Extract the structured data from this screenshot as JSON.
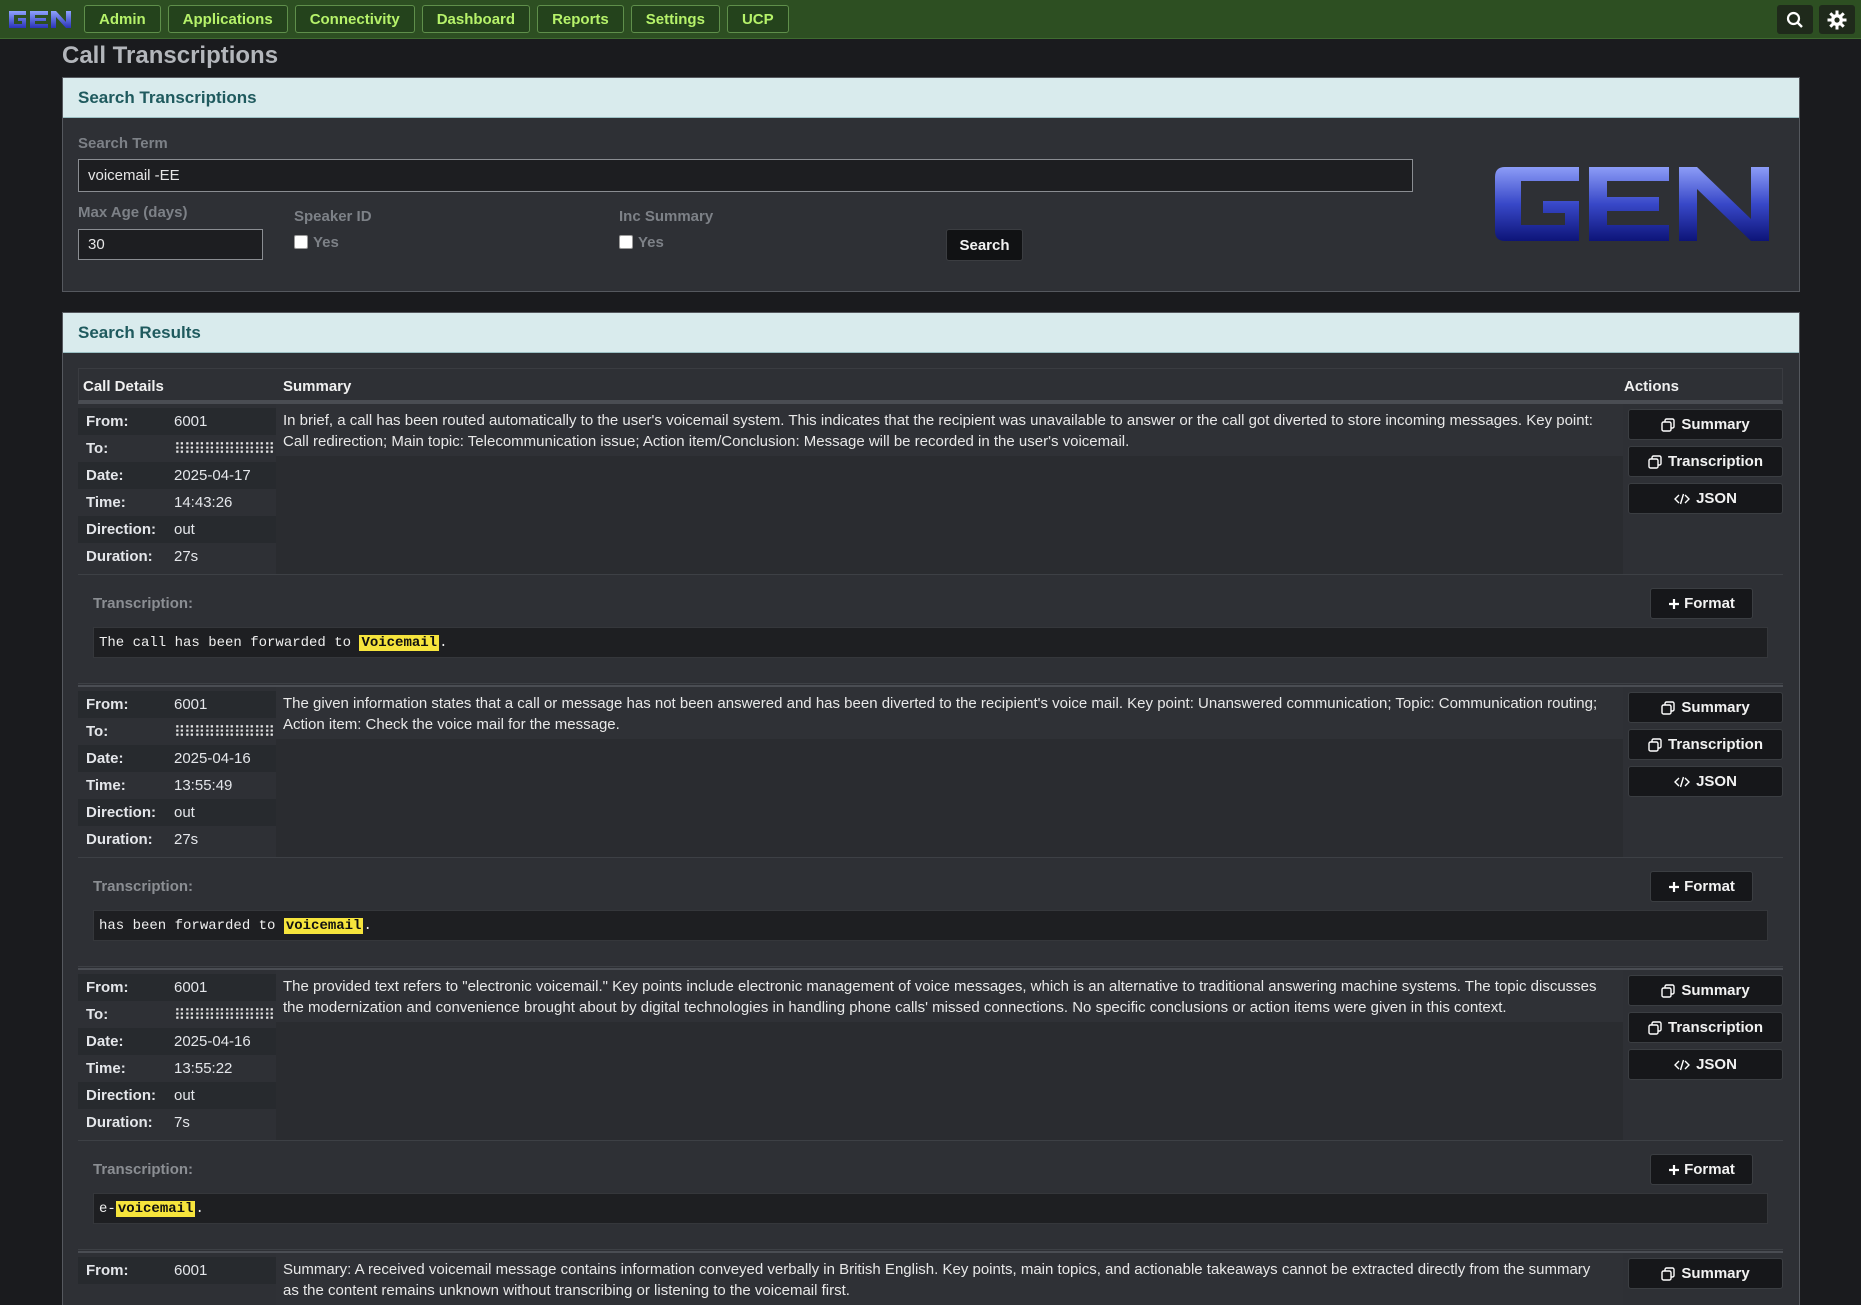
{
  "nav": {
    "logo_alt": "GEN",
    "items": [
      {
        "label": "Admin"
      },
      {
        "label": "Applications"
      },
      {
        "label": "Connectivity"
      },
      {
        "label": "Dashboard"
      },
      {
        "label": "Reports"
      },
      {
        "label": "Settings"
      },
      {
        "label": "UCP"
      }
    ],
    "right_icons": [
      "search-icon",
      "gear-icon"
    ]
  },
  "page": {
    "title": "Call Transcriptions"
  },
  "search": {
    "header": "Search Transcriptions",
    "term_label": "Search Term",
    "term_value": "voicemail -EE",
    "max_age_label": "Max Age (days)",
    "max_age_value": "30",
    "speaker_label": "Speaker ID",
    "speaker_option": "Yes",
    "summary_label": "Inc Summary",
    "summary_option": "Yes",
    "button": "Search"
  },
  "results": {
    "header": "Search Results",
    "columns": {
      "details": "Call Details",
      "summary": "Summary",
      "actions": "Actions"
    },
    "field_labels": {
      "from": "From:",
      "to": "To:",
      "date": "Date:",
      "time": "Time:",
      "direction": "Direction:",
      "duration": "Duration:"
    },
    "action_labels": {
      "summary": "Summary",
      "transcription": "Transcription",
      "json": "JSON",
      "format": "Format",
      "transcription_label": "Transcription:"
    },
    "records": [
      {
        "from": "6001",
        "to": "⠿⠿⠿⠿⠿⠿⠿⠿⠿⠿",
        "date": "2025-04-17",
        "time": "14:43:26",
        "direction": "out",
        "duration": "27s",
        "summary": "In brief, a call has been routed automatically to the user's voicemail system. This indicates that the recipient was unavailable to answer or the call got diverted to store incoming messages. Key point: Call redirection; Main topic: Telecommunication issue; Action item/Conclusion: Message will be recorded in the user's voicemail.",
        "trans_before": "The call has been forwarded to ",
        "trans_highlight": "Voicemail",
        "trans_after": "."
      },
      {
        "from": "6001",
        "to": "⠿⠿⠿⠿⠿⠿⠿⠿⠿⠿",
        "date": "2025-04-16",
        "time": "13:55:49",
        "direction": "out",
        "duration": "27s",
        "summary": "The given information states that a call or message has not been answered and has been diverted to the recipient's voice mail. Key point: Unanswered communication; Topic: Communication routing; Action item: Check the voice mail for the message.",
        "trans_before": "has been forwarded to ",
        "trans_highlight": "voicemail",
        "trans_after": "."
      },
      {
        "from": "6001",
        "to": "⠿⠿⠿⠿⠿⠿⠿⠿⠿⠿",
        "date": "2025-04-16",
        "time": "13:55:22",
        "direction": "out",
        "duration": "7s",
        "summary": "The provided text refers to \"electronic voicemail.\" Key points include electronic management of voice messages, which is an alternative to traditional answering machine systems. The topic discusses the modernization and convenience brought about by digital technologies in handling phone calls' missed connections. No specific conclusions or action items were given in this context.",
        "trans_before": "e-",
        "trans_highlight": "voicemail",
        "trans_after": "."
      },
      {
        "from": "6001",
        "summary": "Summary: A received voicemail message contains information conveyed verbally in British English. Key points, main topics, and actionable takeaways cannot be extracted directly from the summary as the content remains unknown without transcribing or listening to the voicemail first."
      }
    ]
  }
}
